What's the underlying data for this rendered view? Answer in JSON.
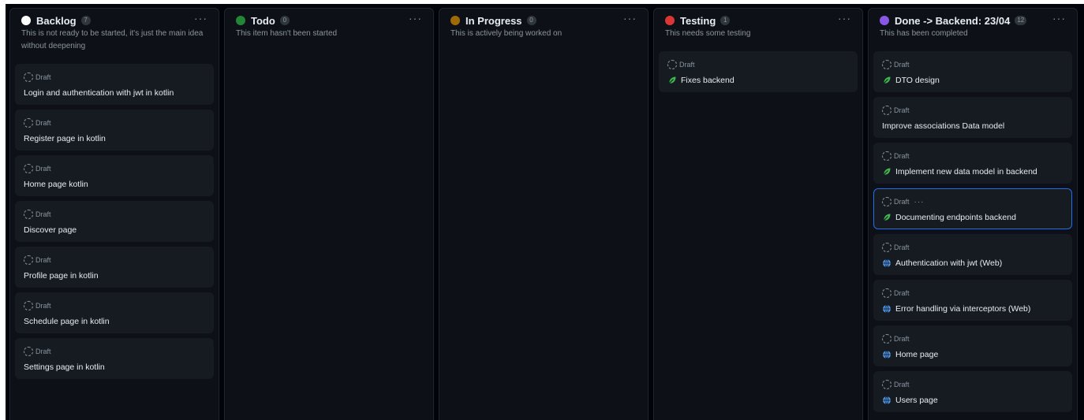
{
  "columns": [
    {
      "title": "Backlog",
      "count": "7",
      "color": "#ffffff",
      "description": "This is not ready to be started, it's just the main idea without deepening",
      "cards": [
        {
          "status": "Draft",
          "title": "Login and authentication with jwt in kotlin",
          "icon": ""
        },
        {
          "status": "Draft",
          "title": "Register page in kotlin",
          "icon": ""
        },
        {
          "status": "Draft",
          "title": "Home page kotlin",
          "icon": ""
        },
        {
          "status": "Draft",
          "title": "Discover page",
          "icon": ""
        },
        {
          "status": "Draft",
          "title": "Profile page in kotlin",
          "icon": ""
        },
        {
          "status": "Draft",
          "title": "Schedule page in kotlin",
          "icon": ""
        },
        {
          "status": "Draft",
          "title": "Settings page in kotlin",
          "icon": ""
        }
      ]
    },
    {
      "title": "Todo",
      "count": "0",
      "color": "#238636",
      "description": "This item hasn't been started",
      "cards": []
    },
    {
      "title": "In Progress",
      "count": "0",
      "color": "#9e6a03",
      "description": "This is actively being worked on",
      "cards": []
    },
    {
      "title": "Testing",
      "count": "1",
      "color": "#da3633",
      "description": "This needs some testing",
      "cards": [
        {
          "status": "Draft",
          "title": "Fixes backend",
          "icon": "leaf-icon"
        }
      ]
    },
    {
      "title": "Done -> Backend: 23/04",
      "count": "12",
      "color": "#8957e5",
      "description": "This has been completed",
      "cards": [
        {
          "status": "Draft",
          "title": "DTO design",
          "icon": "leaf-icon"
        },
        {
          "status": "Draft",
          "title": "Improve associations Data model",
          "icon": ""
        },
        {
          "status": "Draft",
          "title": "Implement new data model in backend",
          "icon": "leaf-icon"
        },
        {
          "status": "Draft",
          "title": "Documenting endpoints backend",
          "icon": "leaf-icon",
          "selected": true
        },
        {
          "status": "Draft",
          "title": "Authentication with jwt (Web)",
          "icon": "globe-icon"
        },
        {
          "status": "Draft",
          "title": "Error handling via interceptors (Web)",
          "icon": "globe-icon"
        },
        {
          "status": "Draft",
          "title": "Home page",
          "icon": "globe-icon"
        },
        {
          "status": "Draft",
          "title": "Users page",
          "icon": "globe-icon"
        }
      ]
    }
  ],
  "more_glyph": "···"
}
